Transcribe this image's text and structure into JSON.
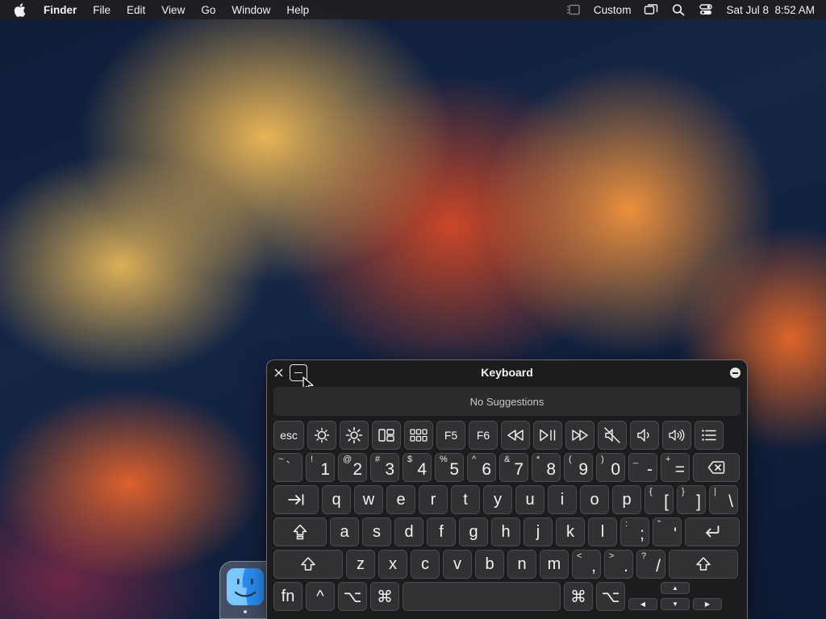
{
  "menubar": {
    "app_name": "Finder",
    "menus": [
      "File",
      "Edit",
      "View",
      "Go",
      "Window",
      "Help"
    ],
    "input_source": "Custom",
    "datetime": "Sat Jul 8  8:52 AM"
  },
  "keyboard": {
    "title": "Keyboard",
    "suggestions": "No Suggestions",
    "function_row": [
      "esc",
      "brightness-down-icon",
      "brightness-up-icon",
      "mission-control-icon",
      "launchpad-icon",
      "F5",
      "F6",
      "rewind-icon",
      "play-pause-icon",
      "fast-forward-icon",
      "mute-icon",
      "volume-down-icon",
      "volume-up-icon",
      "list-icon"
    ],
    "f5": "F5",
    "f6": "F6",
    "esc": "esc",
    "number_row": [
      {
        "sec": "~",
        "pri": "`"
      },
      {
        "sec": "!",
        "pri": "1"
      },
      {
        "sec": "@",
        "pri": "2"
      },
      {
        "sec": "#",
        "pri": "3"
      },
      {
        "sec": "$",
        "pri": "4"
      },
      {
        "sec": "%",
        "pri": "5"
      },
      {
        "sec": "^",
        "pri": "6"
      },
      {
        "sec": "&",
        "pri": "7"
      },
      {
        "sec": "*",
        "pri": "8"
      },
      {
        "sec": "(",
        "pri": "9"
      },
      {
        "sec": ")",
        "pri": "0"
      },
      {
        "sec": "_",
        "pri": "-"
      },
      {
        "sec": "+",
        "pri": "="
      }
    ],
    "top_row": [
      "q",
      "w",
      "e",
      "r",
      "t",
      "y",
      "u",
      "i",
      "o",
      "p"
    ],
    "top_row_symbols": [
      {
        "sec": "{",
        "pri": "["
      },
      {
        "sec": "}",
        "pri": "]"
      },
      {
        "sec": "|",
        "pri": "\\"
      }
    ],
    "home_row": [
      "a",
      "s",
      "d",
      "f",
      "g",
      "h",
      "j",
      "k",
      "l"
    ],
    "home_row_symbols": [
      {
        "sec": ":",
        "pri": ";"
      },
      {
        "sec": "\"",
        "pri": "'"
      }
    ],
    "bottom_row": [
      "z",
      "x",
      "c",
      "v",
      "b",
      "n",
      "m"
    ],
    "bottom_row_symbols": [
      {
        "sec": "<",
        "pri": ","
      },
      {
        "sec": ">",
        "pri": "."
      },
      {
        "sec": "?",
        "pri": "/"
      }
    ],
    "modifiers": {
      "fn": "fn",
      "control": "^",
      "option": "⌥",
      "command": "⌘"
    },
    "arrows": {
      "up": "▲",
      "left": "◀",
      "down": "▼",
      "right": "▶"
    }
  }
}
